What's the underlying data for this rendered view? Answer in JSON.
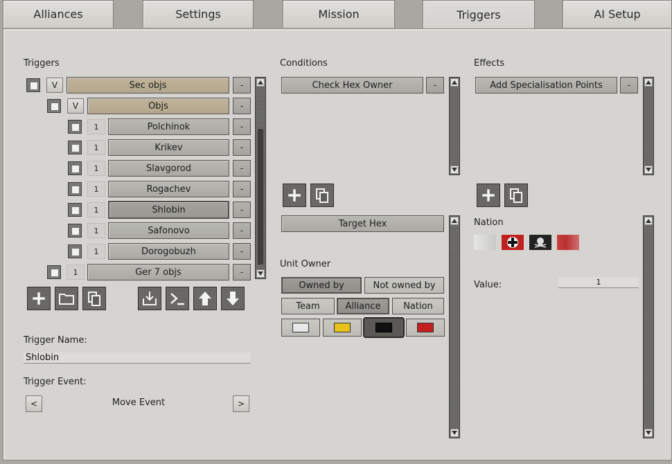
{
  "tabs": [
    {
      "label": "Alliances"
    },
    {
      "label": "Settings"
    },
    {
      "label": "Mission"
    },
    {
      "label": "Triggers"
    },
    {
      "label": "AI Setup"
    }
  ],
  "active_tab": "Triggers",
  "triggers": {
    "heading": "Triggers",
    "rows": [
      {
        "toggle": "V",
        "name": "Sec objs",
        "remove": "-"
      },
      {
        "toggle": "V",
        "name": "Objs",
        "remove": "-"
      },
      {
        "count": "1",
        "name": "Polchinok",
        "remove": "-"
      },
      {
        "count": "1",
        "name": "Krikev",
        "remove": "-"
      },
      {
        "count": "1",
        "name": "Slavgorod",
        "remove": "-"
      },
      {
        "count": "1",
        "name": "Rogachev",
        "remove": "-"
      },
      {
        "count": "1",
        "name": "Shlobin",
        "remove": "-"
      },
      {
        "count": "1",
        "name": "Safonovo",
        "remove": "-"
      },
      {
        "count": "1",
        "name": "Dorogobuzh",
        "remove": "-"
      },
      {
        "count": "1",
        "name": "Ger 7 objs",
        "remove": "-"
      }
    ],
    "name_label": "Trigger Name:",
    "name_value": "Shlobin",
    "event_label": "Trigger Event:",
    "event_value": "Move Event",
    "prev": "<",
    "next": ">"
  },
  "conditions": {
    "heading": "Conditions",
    "items": [
      {
        "name": "Check Hex Owner",
        "remove": "-"
      }
    ],
    "target_hex": "Target Hex",
    "unit_owner_label": "Unit Owner",
    "owned_by": "Owned by",
    "not_owned_by": "Not owned by",
    "team": "Team",
    "alliance": "Alliance",
    "nation": "Nation",
    "colors": [
      "#e8e8e8",
      "#e8c21a",
      "#111111",
      "#c42020"
    ]
  },
  "effects": {
    "heading": "Effects",
    "items": [
      {
        "name": "Add Specialisation Points",
        "remove": "-"
      }
    ],
    "nation_label": "Nation",
    "value_label": "Value:",
    "value": "1"
  }
}
